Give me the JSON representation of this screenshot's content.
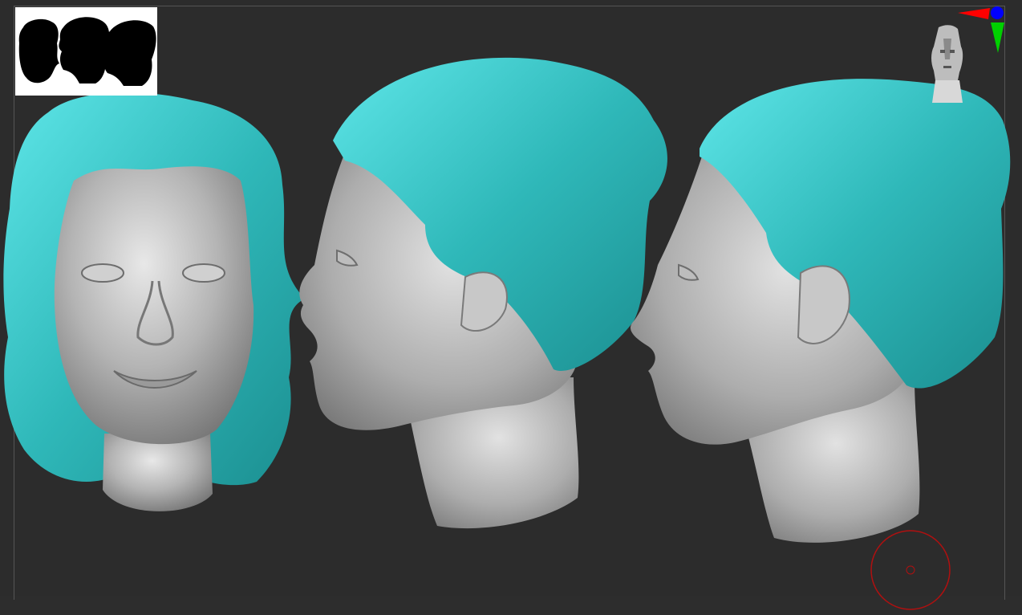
{
  "app": {
    "name": "",
    "background_color": "#2c2c2c"
  },
  "scene": {
    "models": [
      {
        "view": "front",
        "hair_color": "#2fb8b9",
        "skin_color": "#a9a9a9"
      },
      {
        "view": "side-left",
        "hair_color": "#2fb8b9",
        "skin_color": "#a9a9a9"
      },
      {
        "view": "side-left",
        "hair_color": "#2fb8b9",
        "skin_color": "#a9a9a9"
      }
    ]
  },
  "overlays": {
    "silhouette_panel": {
      "icon": "silhouette-thumbnail-icon",
      "count": 3
    },
    "nav_cube": {
      "icon": "head-navigation-icon"
    },
    "axis_gizmo": {
      "x_color": "#ff0000",
      "y_color": "#00d000",
      "z_color": "#0000ff"
    },
    "brush_cursor": {
      "color": "#b01010"
    }
  }
}
